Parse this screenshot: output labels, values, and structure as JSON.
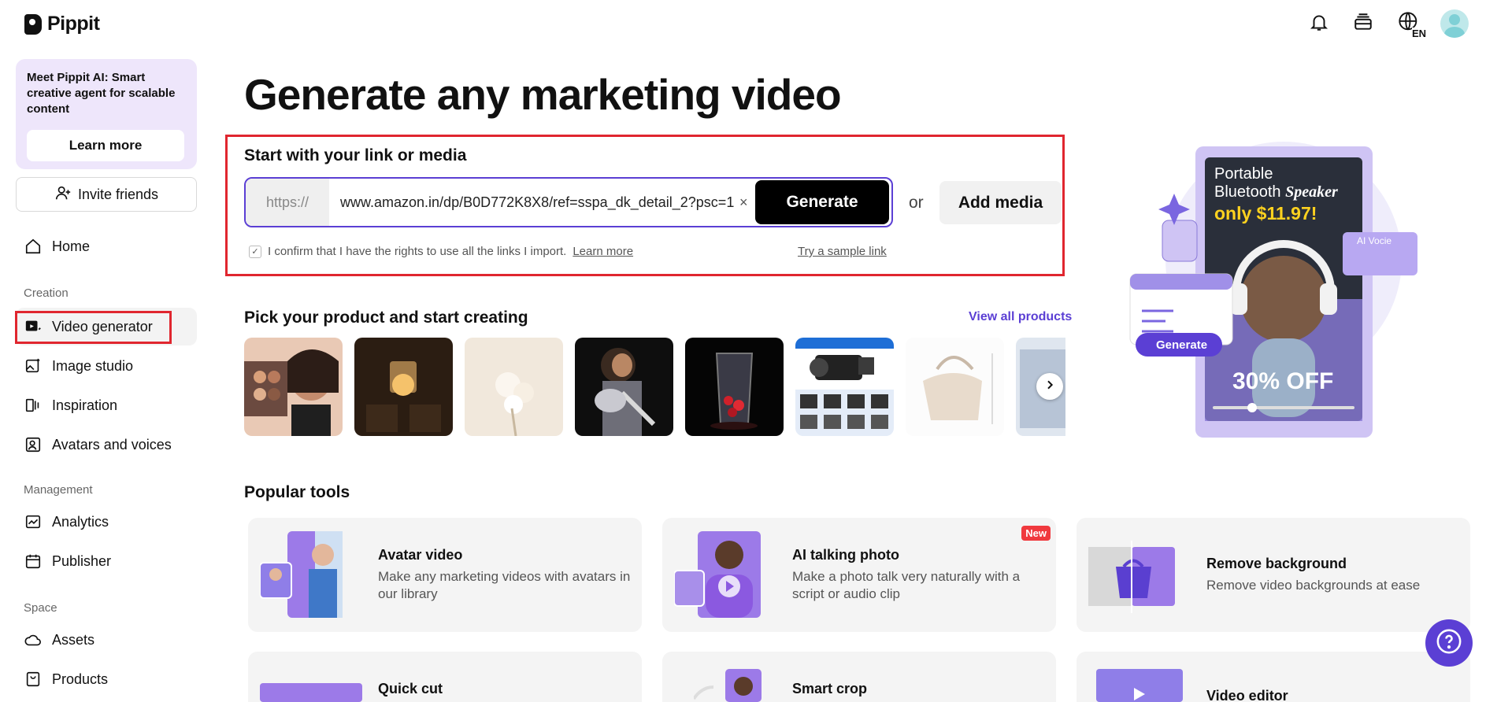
{
  "brand": {
    "name": "Pippit"
  },
  "header": {
    "icons": [
      "bell-icon",
      "inbox-icon",
      "language-icon",
      "avatar"
    ],
    "language_badge": "EN"
  },
  "sidebar": {
    "promo_text": "Meet Pippit AI: Smart creative agent for scalable content",
    "promo_button": "Learn more",
    "invite_label": "Invite friends",
    "home_label": "Home",
    "section_creation": "Creation",
    "creation_items": [
      {
        "label": "Video generator",
        "icon": "video-generator-icon"
      },
      {
        "label": "Image studio",
        "icon": "image-studio-icon"
      },
      {
        "label": "Inspiration",
        "icon": "inspiration-icon"
      },
      {
        "label": "Avatars and voices",
        "icon": "avatar-voice-icon"
      }
    ],
    "section_management": "Management",
    "management_items": [
      {
        "label": "Analytics",
        "icon": "analytics-icon"
      },
      {
        "label": "Publisher",
        "icon": "calendar-icon"
      }
    ],
    "section_space": "Space",
    "space_items": [
      {
        "label": "Assets",
        "icon": "cloud-icon"
      },
      {
        "label": "Products",
        "icon": "products-icon"
      }
    ]
  },
  "main": {
    "title": "Generate any marketing video",
    "link_section_label": "Start with your link or media",
    "url_prefix": "https://",
    "url_value": "www.amazon.in/dp/B0D772K8X8/ref=sspa_dk_detail_2?psc=1",
    "clear_symbol": "×",
    "generate_label": "Generate",
    "or_label": "or",
    "add_media_label": "Add media",
    "confirm_text": "I confirm that I have the rights to use all the links I import.",
    "confirm_link": "Learn more",
    "sample_link": "Try a sample link",
    "pick_title": "Pick your product and start creating",
    "view_all": "View all products",
    "products": [
      "product-makeup-palette",
      "product-candle-lamp",
      "product-flowers",
      "product-guitar",
      "product-vase",
      "product-video-camera",
      "product-handbag",
      "product-partial"
    ],
    "tools_title": "Popular tools",
    "tools": [
      {
        "name": "Avatar video",
        "desc": "Make any marketing videos with avatars in our library"
      },
      {
        "name": "AI talking photo",
        "desc": "Make a photo talk very naturally with a script or audio clip",
        "badge": "New"
      },
      {
        "name": "Remove background",
        "desc": "Remove video backgrounds at ease"
      },
      {
        "name": "Quick cut",
        "desc": ""
      },
      {
        "name": "Smart crop",
        "desc": ""
      },
      {
        "name": "Video editor",
        "desc": ""
      }
    ]
  },
  "hero": {
    "line1": "Portable",
    "line2a": "Bluetooth ",
    "line2b": "Speaker",
    "price": "only $11.97!",
    "voice_label": "AI Vocie",
    "generate_chip": "Generate",
    "discount": "30% OFF"
  },
  "colors": {
    "accent": "#5b3fd4",
    "highlight_red": "#e0262f",
    "promo_bg": "#eee6fb"
  }
}
